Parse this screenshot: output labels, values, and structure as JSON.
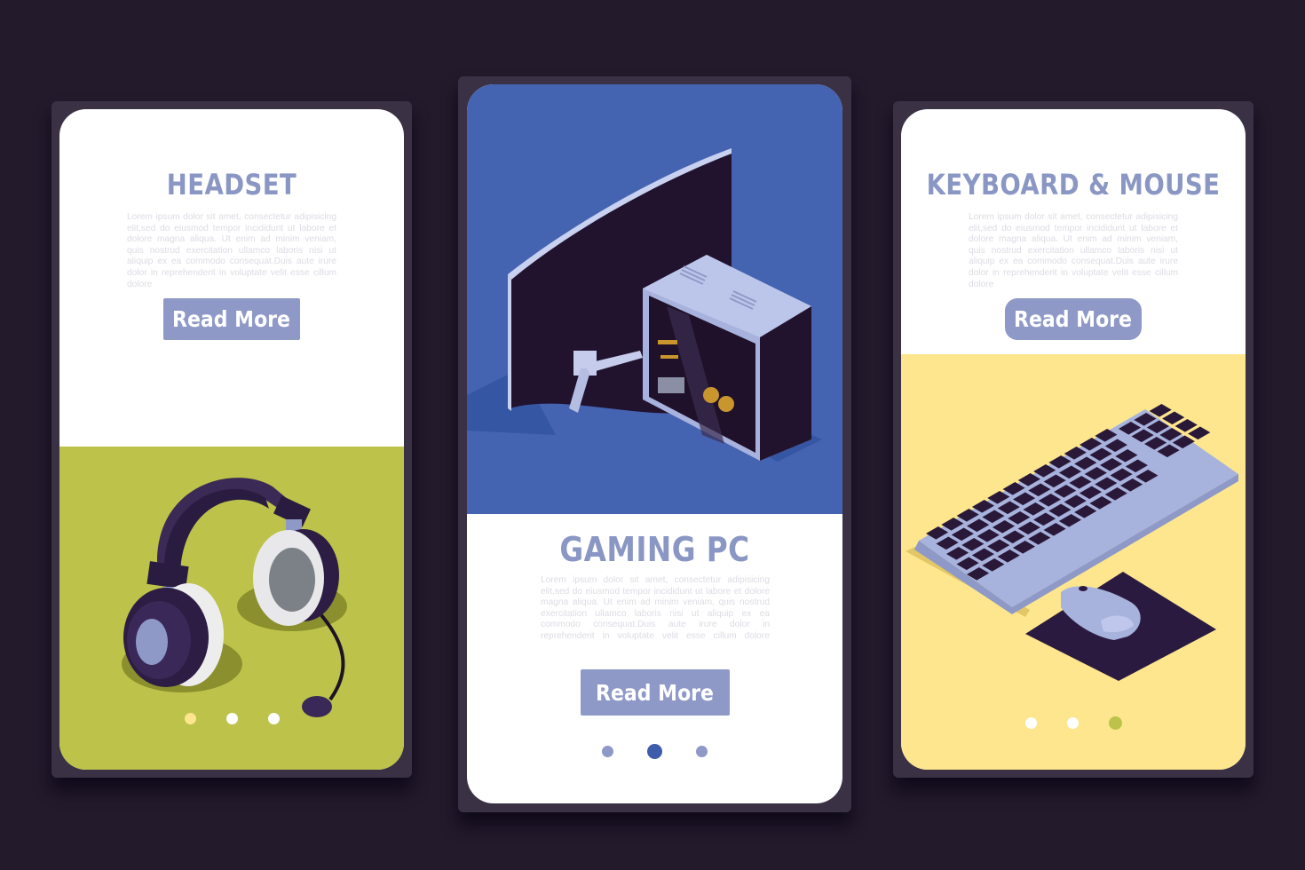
{
  "colors": {
    "background": "#231a2b",
    "frame": "#3a3145",
    "title": "#8a97c4",
    "button": "#8e99c7",
    "headset_panel": "#bdc34a",
    "gaming_panel": "#4463b1",
    "keyboard_panel": "#fde68d",
    "dark_object": "#231331",
    "light_object": "#a7b3dd"
  },
  "cards": [
    {
      "id": "headset",
      "title": "HEADSET",
      "body": "Lorem ipsum dolor sit amet, consectetur adipisicing elit,sed do eiusmod tempor incididunt ut labore et dolore magna aliqua. Ut enim ad minim veniam, quis nostrud exercitation ullamco laboris nisi ut aliquip ex ea commodo consequat.Duis aute irure dolor in reprehenderit in voluptate velit esse cillum dolore",
      "button_label": "Read More",
      "illustration": "headset-icon",
      "pagination": {
        "total": 3,
        "active": 1,
        "active_color": "#fde68d",
        "inactive_color": "#ffffff"
      }
    },
    {
      "id": "gaming-pc",
      "title": "GAMING PC",
      "body": "Lorem ipsum dolor sit amet, consectetur adipisicing elit,sed do eiusmod tempor incididunt ut labore et dolore magna aliqua. Ut enim ad minim veniam, quis nostrud exercitation ullamco laboris nisi ut aliquip ex ea commodo consequat.Duis aute irure dolor in reprehenderit in voluptate velit esse cillum dolore",
      "button_label": "Read More",
      "illustration": "gaming-pc-icon",
      "pagination": {
        "total": 3,
        "active": 2,
        "active_color": "#3d5cab",
        "inactive_color": "#8e99c7"
      }
    },
    {
      "id": "keyboard-mouse",
      "title": "KEYBOARD & MOUSE",
      "body": "Lorem ipsum dolor sit amet, consectetur adipisicing elit,sed do eiusmod tempor incididunt ut labore et dolore magna aliqua. Ut enim ad minim veniam, quis nostrud exercitation ullamco laboris nisi ut aliquip ex ea commodo consequat.Duis aute irure dolor in reprehenderit in voluptate velit esse cillum dolore",
      "button_label": "Read More",
      "illustration": "keyboard-mouse-icon",
      "pagination": {
        "total": 3,
        "active": 3,
        "active_color": "#bdc34a",
        "inactive_color": "#ffffff"
      }
    }
  ]
}
